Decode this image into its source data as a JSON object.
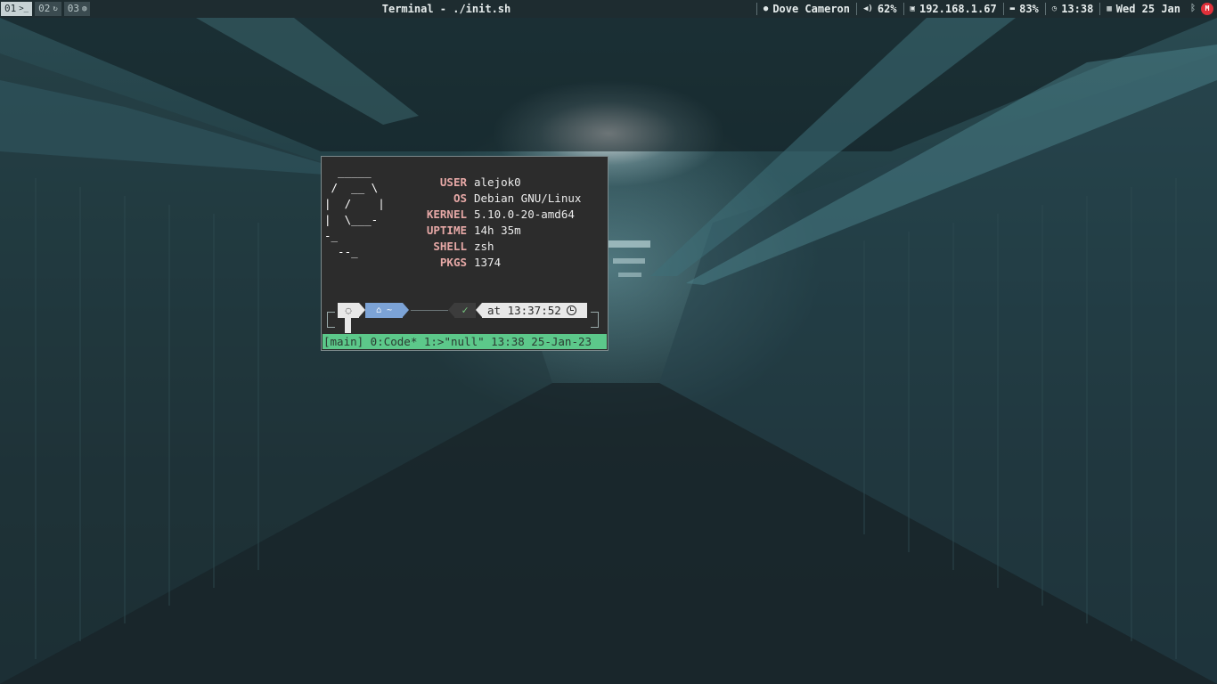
{
  "workspaces": [
    {
      "label": "01",
      "icon": ">_",
      "active": true
    },
    {
      "label": "02",
      "icon": "↻",
      "active": false
    },
    {
      "label": "03",
      "icon": "◍",
      "active": false
    }
  ],
  "window_title": "Terminal - ./init.sh",
  "status": {
    "user": "Dove Cameron",
    "volume": "62%",
    "ip": "192.168.1.67",
    "battery": "83%",
    "time": "13:38",
    "date": "Wed 25 Jan",
    "notify_badge": "M"
  },
  "terminal": {
    "ascii_art": "  _____\n /  __ \\\n|  /    |\n|  \\___-\n-_\n  --_",
    "info": [
      {
        "key": "USER",
        "value": "alejok0"
      },
      {
        "key": "OS",
        "value": "Debian GNU/Linux"
      },
      {
        "key": "KERNEL",
        "value": "5.10.0-20-amd64"
      },
      {
        "key": "UPTIME",
        "value": "14h 35m"
      },
      {
        "key": "SHELL",
        "value": "zsh"
      },
      {
        "key": "PKGS",
        "value": "1374"
      }
    ],
    "prompt": {
      "os_icon": "◌",
      "dir_icon": "⌂",
      "dir": "~",
      "status_icon": "✓",
      "time_text": "at 13:37:52"
    },
    "tmux_status": "[main] 0:Code* 1:>\"null\" 13:38 25-Jan-23"
  },
  "colors": {
    "bar_bg": "#1e2c30",
    "terminal_bg": "#2c2c2c",
    "key_color": "#e6a8a6",
    "dir_segment": "#7ca3d6",
    "tmux_bar": "#5cc88a",
    "ok_green": "#76c47e",
    "notify_red": "#e0303a"
  }
}
